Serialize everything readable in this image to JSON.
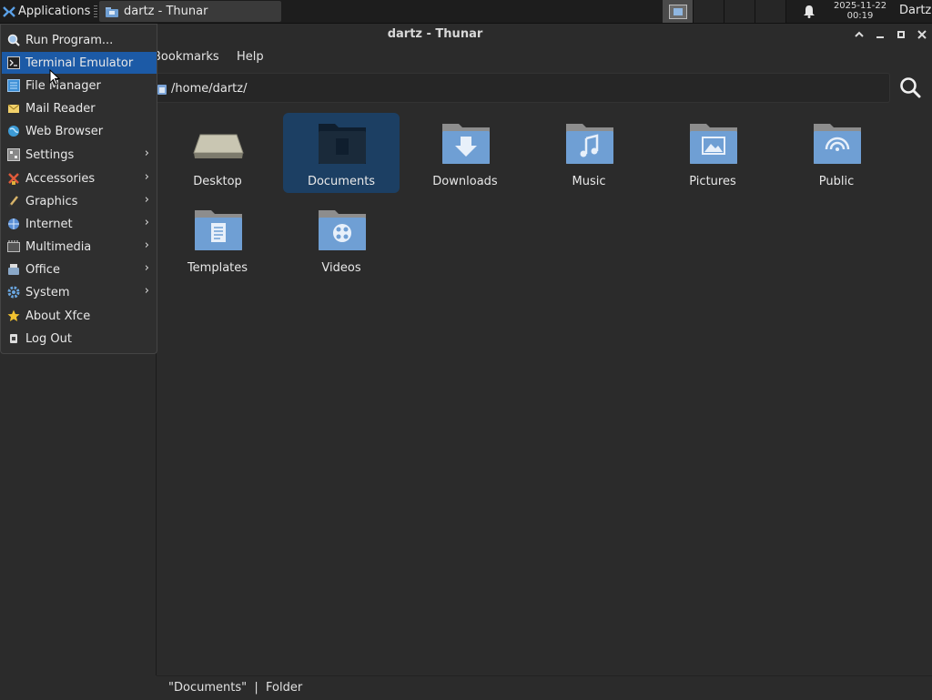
{
  "panel": {
    "applications_label": "Applications",
    "task_label": "dartz - Thunar",
    "clock_date": "2025-11-22",
    "clock_time": "00:19",
    "user_label": "Dartz"
  },
  "window": {
    "title": "dartz - Thunar",
    "menubar": {
      "bookmarks": "Bookmarks",
      "help": "Help"
    },
    "location": "/home/dartz/",
    "items": [
      {
        "name": "Desktop",
        "icon": "desktop-folder-icon"
      },
      {
        "name": "Documents",
        "icon": "documents-folder-icon",
        "selected": true
      },
      {
        "name": "Downloads",
        "icon": "downloads-folder-icon"
      },
      {
        "name": "Music",
        "icon": "music-folder-icon"
      },
      {
        "name": "Pictures",
        "icon": "pictures-folder-icon"
      },
      {
        "name": "Public",
        "icon": "public-folder-icon"
      },
      {
        "name": "Templates",
        "icon": "templates-folder-icon"
      },
      {
        "name": "Videos",
        "icon": "videos-folder-icon"
      }
    ],
    "status": "\"Documents\"  |  Folder"
  },
  "app_menu": {
    "items": [
      {
        "label": "Run Program...",
        "icon": "run-icon"
      },
      {
        "label": "Terminal Emulator",
        "icon": "terminal-icon",
        "highlighted": true
      },
      {
        "label": "File Manager",
        "icon": "file-manager-icon"
      },
      {
        "label": "Mail Reader",
        "icon": "mail-icon"
      },
      {
        "label": "Web Browser",
        "icon": "web-browser-icon"
      },
      {
        "label": "Settings",
        "icon": "settings-icon",
        "submenu": true
      },
      {
        "label": "Accessories",
        "icon": "accessories-icon",
        "submenu": true
      },
      {
        "label": "Graphics",
        "icon": "graphics-icon",
        "submenu": true
      },
      {
        "label": "Internet",
        "icon": "internet-icon",
        "submenu": true
      },
      {
        "label": "Multimedia",
        "icon": "multimedia-icon",
        "submenu": true
      },
      {
        "label": "Office",
        "icon": "office-icon",
        "submenu": true
      },
      {
        "label": "System",
        "icon": "system-icon",
        "submenu": true
      },
      {
        "label": "About Xfce",
        "icon": "star-icon"
      },
      {
        "label": "Log Out",
        "icon": "logout-icon"
      }
    ]
  },
  "colors": {
    "highlight": "#1c5aa6",
    "selection": "#1c3f63",
    "folder_blue": "#6f9fd4"
  }
}
